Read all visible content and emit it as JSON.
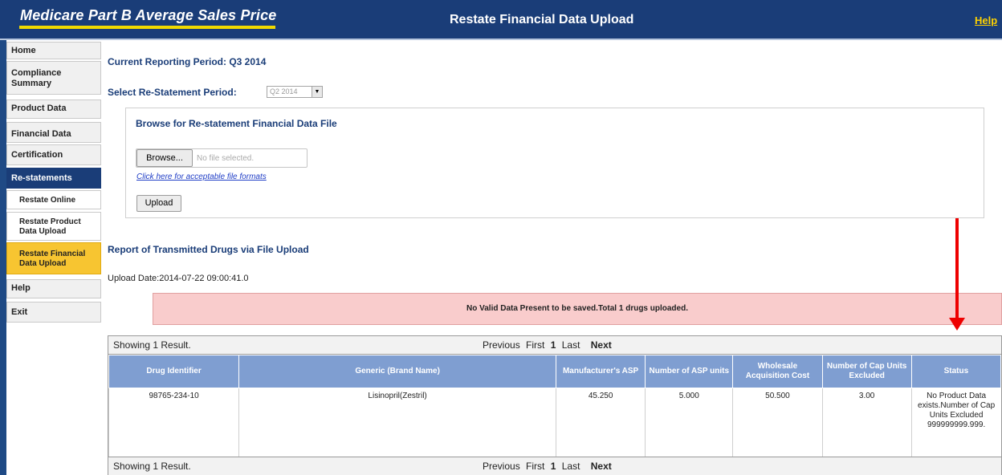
{
  "header": {
    "app_title": "Medicare Part B Average Sales Price",
    "page_heading": "Restate Financial Data Upload",
    "help_link": "Help"
  },
  "sidebar": {
    "items": [
      {
        "label": "Home"
      },
      {
        "label": "Compliance Summary"
      },
      {
        "label": "Product Data"
      },
      {
        "label": "Financial Data"
      },
      {
        "label": "Certification"
      },
      {
        "label": "Re-statements"
      },
      {
        "label": "Restate Online"
      },
      {
        "label": "Restate Product Data Upload"
      },
      {
        "label": "Restate Financial Data Upload"
      },
      {
        "label": "Help"
      },
      {
        "label": "Exit"
      }
    ]
  },
  "main": {
    "current_period": "Current Reporting Period: Q3 2014",
    "restatement_label": "Select Re-Statement Period:",
    "restatement_value": "Q2 2014",
    "browse_heading": "Browse for Re-statement Financial Data File",
    "browse_button": "Browse...",
    "file_placeholder": "No file selected.",
    "formats_link": "Click here for acceptable file formats",
    "upload_button": "Upload",
    "report_heading": "Report of Transmitted Drugs via File Upload",
    "upload_date": "Upload Date:2014-07-22 09:00:41.0",
    "error_message": "No Valid Data Present to be saved.Total 1 drugs uploaded."
  },
  "pager": {
    "result_text": "Showing 1 Result.",
    "previous": "Previous",
    "first": "First",
    "current_page": "1",
    "last": "Last",
    "next": "Next"
  },
  "table": {
    "headers": [
      "Drug Identifier",
      "Generic (Brand Name)",
      "Manufacturer's ASP",
      "Number of ASP units",
      "Wholesale Acquisition Cost",
      "Number of Cap Units Excluded",
      "Status"
    ],
    "rows": [
      [
        "98765-234-10",
        "Lisinopril(Zestril)",
        "45.250",
        "5.000",
        "50.500",
        "3.00",
        "No Product Data exists.Number of Cap Units Excluded 999999999.999."
      ]
    ]
  },
  "colors": {
    "header_bg": "#1a3d78",
    "title_underline": "#f0d900",
    "help_link": "#ffd200",
    "active_nav": "#1a3d78",
    "selected_sub": "#f7c531",
    "error_bg": "#f9cccc",
    "table_header": "#7f9ed1",
    "annotation_arrow": "#ee0000"
  }
}
